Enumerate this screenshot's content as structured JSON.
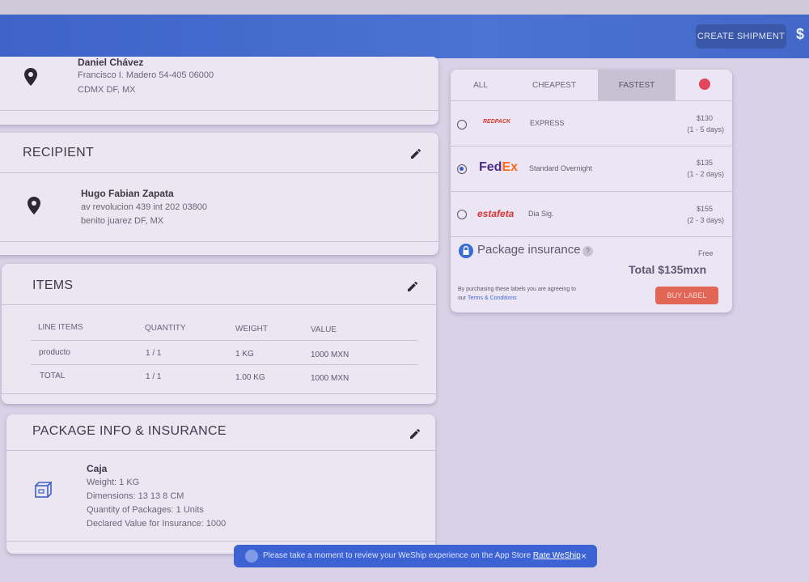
{
  "appbar": {
    "create_shipment_label": "CREATE SHIPMENT",
    "currency_symbol": "$"
  },
  "sender": {
    "name": "Daniel Chávez",
    "address_line1": "Francisco I. Madero 54-405 06000",
    "address_line2": "CDMX DF, MX"
  },
  "recipient": {
    "title": "RECIPIENT",
    "name": "Hugo Fabian Zapata",
    "address_line1": "av revolucion 439 int 202 03800",
    "address_line2": "benito juarez DF, MX"
  },
  "items": {
    "title": "ITEMS",
    "headers": [
      "LINE ITEMS",
      "QUANTITY",
      "WEIGHT",
      "VALUE"
    ],
    "rows": [
      [
        "producto",
        "1 / 1",
        "1 KG",
        "1000 MXN"
      ]
    ],
    "total": [
      "TOTAL",
      "1 / 1",
      "1.00 KG",
      "1000 MXN"
    ]
  },
  "package": {
    "title": "PACKAGE INFO & INSURANCE",
    "name": "Caja",
    "weight": "Weight: 1 KG",
    "dimensions": "Dimensions: 13 13 8 CM",
    "quantity": "Quantity of Packages: 1 Units",
    "declared_value": "Declared Value for Insurance: 1000"
  },
  "carriers": {
    "tabs": [
      "ALL",
      "CHEAPEST",
      "FASTEST"
    ],
    "active_tab": "FASTEST",
    "options": [
      {
        "carrier": "REDPACK",
        "service": "EXPRESS",
        "price": "$130",
        "eta": "(1 - 5 days)",
        "selected": false,
        "color": "#d33a2f"
      },
      {
        "carrier": "FedEx",
        "service": "Standard Overnight",
        "price": "$135",
        "eta": "(1 - 2 days)",
        "selected": true,
        "color": "#4d2a8c"
      },
      {
        "carrier": "estafeta",
        "service": "Dia Sig.",
        "price": "$155",
        "eta": "(2 - 3 days)",
        "selected": false,
        "color": "#d63434"
      }
    ],
    "insurance_label": "Package insurance",
    "insurance_help": "?",
    "insurance_price": "Free",
    "total": "Total $135mxn",
    "agree_text": "By purchasing these labels you are agreeing to our",
    "terms_link": "Terms & Conditions",
    "buy_label": "BUY LABEL"
  },
  "snackbar": {
    "message": "Please take a moment to review your WeShip experience on the App Store",
    "link": "Rate WeShip",
    "close": "×"
  }
}
